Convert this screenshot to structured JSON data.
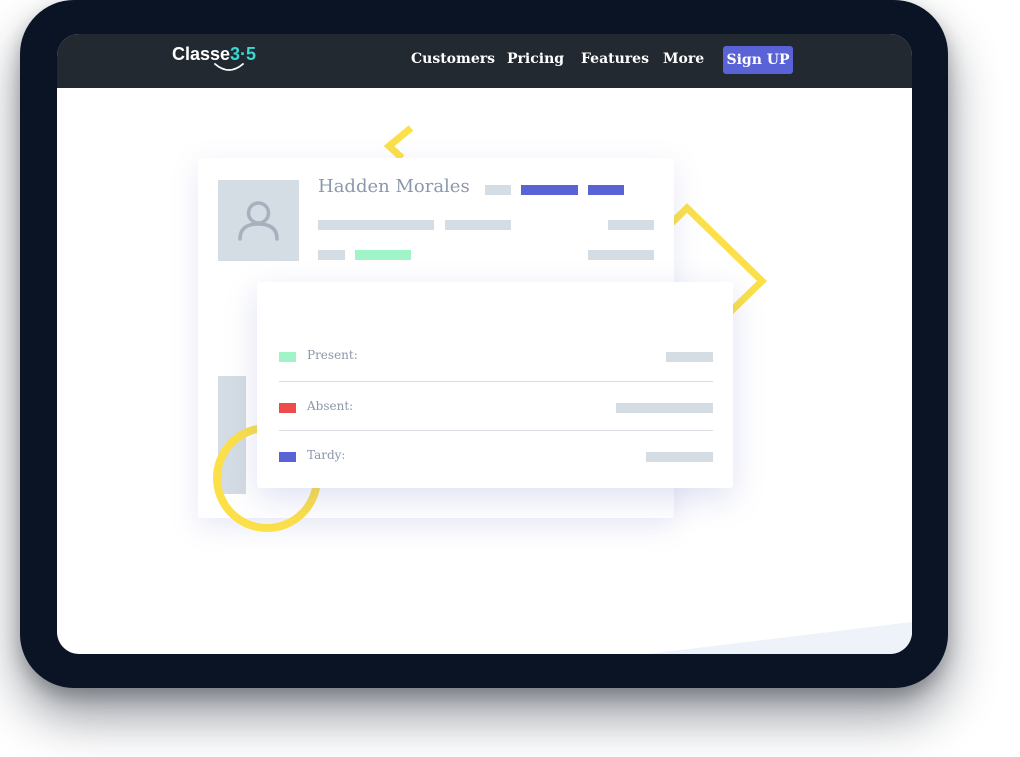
{
  "brand": {
    "logo_prefix": "Classe",
    "logo_digits": "3·5"
  },
  "nav": {
    "items": [
      {
        "label": "Customers"
      },
      {
        "label": "Pricing"
      },
      {
        "label": "Features"
      },
      {
        "label": "More"
      }
    ],
    "cta_label": "Sign UP"
  },
  "profile": {
    "name": "Hadden Morales"
  },
  "attendance": {
    "rows": [
      {
        "label": "Present:",
        "color": "#9ff5c8"
      },
      {
        "label": "Absent:",
        "color": "#ee4b4b"
      },
      {
        "label": "Tardy:",
        "color": "#5a63d6"
      }
    ]
  },
  "colors": {
    "device_frame": "#0b1424",
    "navbar": "#232931",
    "accent": "#5a63d6",
    "logo_accent": "#38d7d0",
    "decor_yellow": "#fbe04a",
    "placeholder_grey": "#d4dce4"
  },
  "icons": {
    "avatar": "user-silhouette-icon"
  }
}
